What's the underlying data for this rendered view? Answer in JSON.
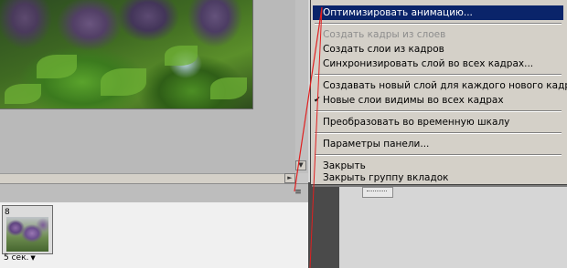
{
  "context_menu": {
    "items": [
      {
        "label": "Оптимизировать анимацию...",
        "state": "highlighted"
      },
      {
        "label": "Создать кадры из слоев",
        "state": "disabled"
      },
      {
        "label": "Создать слои из кадров",
        "state": "normal"
      },
      {
        "label": "Синхронизировать слой во всех кадрах...",
        "state": "normal"
      },
      {
        "label": "Создавать новый слой для каждого нового кадра",
        "state": "normal"
      },
      {
        "label": "Новые слои видимы во всех кадрах",
        "state": "normal",
        "checked": true
      },
      {
        "label": "Преобразовать во временную шкалу",
        "state": "normal"
      },
      {
        "label": "Параметры панели...",
        "state": "normal"
      },
      {
        "label": "Закрыть",
        "state": "normal"
      },
      {
        "label": "Закрыть группу вкладок",
        "state": "normal"
      }
    ]
  },
  "animation_panel": {
    "frame_number": "8",
    "frame_delay": "5 сек.",
    "frame_delay_arrow": "▼",
    "panel_menu_icon": "≡"
  },
  "scroll": {
    "down_arrow": "▼",
    "right_arrow": "►"
  },
  "colors": {
    "menu_highlight": "#0a246a",
    "menu_background": "#d4d0c8",
    "pointer_line": "#e02020"
  }
}
